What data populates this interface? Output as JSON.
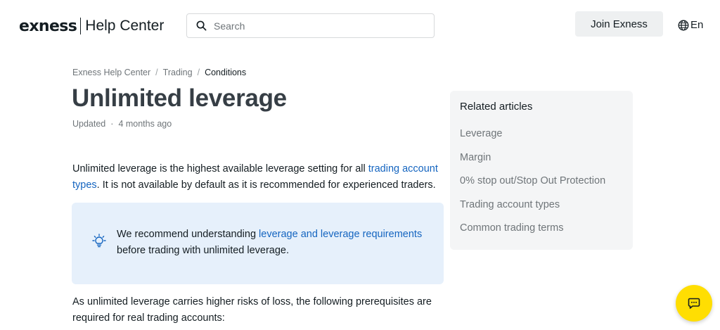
{
  "header": {
    "logo_wordmark": "exness",
    "logo_subtitle": "Help Center",
    "search_placeholder": "Search",
    "join_button": "Join Exness",
    "language": "En"
  },
  "breadcrumb": {
    "items": [
      "Exness Help Center",
      "Trading",
      "Conditions"
    ],
    "separator": "/"
  },
  "article": {
    "title": "Unlimited leverage",
    "meta_label": "Updated",
    "meta_dot": "·",
    "meta_time": "4 months ago",
    "para1_before": "Unlimited leverage is the highest available leverage setting for all ",
    "para1_link": "trading account types",
    "para1_after": ". It is not available by default as it is recommended for experienced traders.",
    "callout_before": "We recommend understanding ",
    "callout_link": "leverage and leverage requirements",
    "callout_after": " before trading with unlimited leverage.",
    "para2": "As unlimited leverage carries higher risks of loss, the following prerequisites are required for real trading accounts:"
  },
  "related": {
    "title": "Related articles",
    "items": [
      "Leverage",
      "Margin",
      "0% stop out/Stop Out Protection",
      "Trading account types",
      "Common trading terms"
    ]
  },
  "icons": {
    "search": "search-icon",
    "language": "globe-icon",
    "callout": "lightbulb-icon",
    "chat": "chat-icon"
  },
  "colors": {
    "link": "#1565c0",
    "callout_bg": "#e6f0fb",
    "related_bg": "#f4f5f6",
    "chat_button": "#ffde02",
    "join_button_bg": "#eef0f1"
  }
}
